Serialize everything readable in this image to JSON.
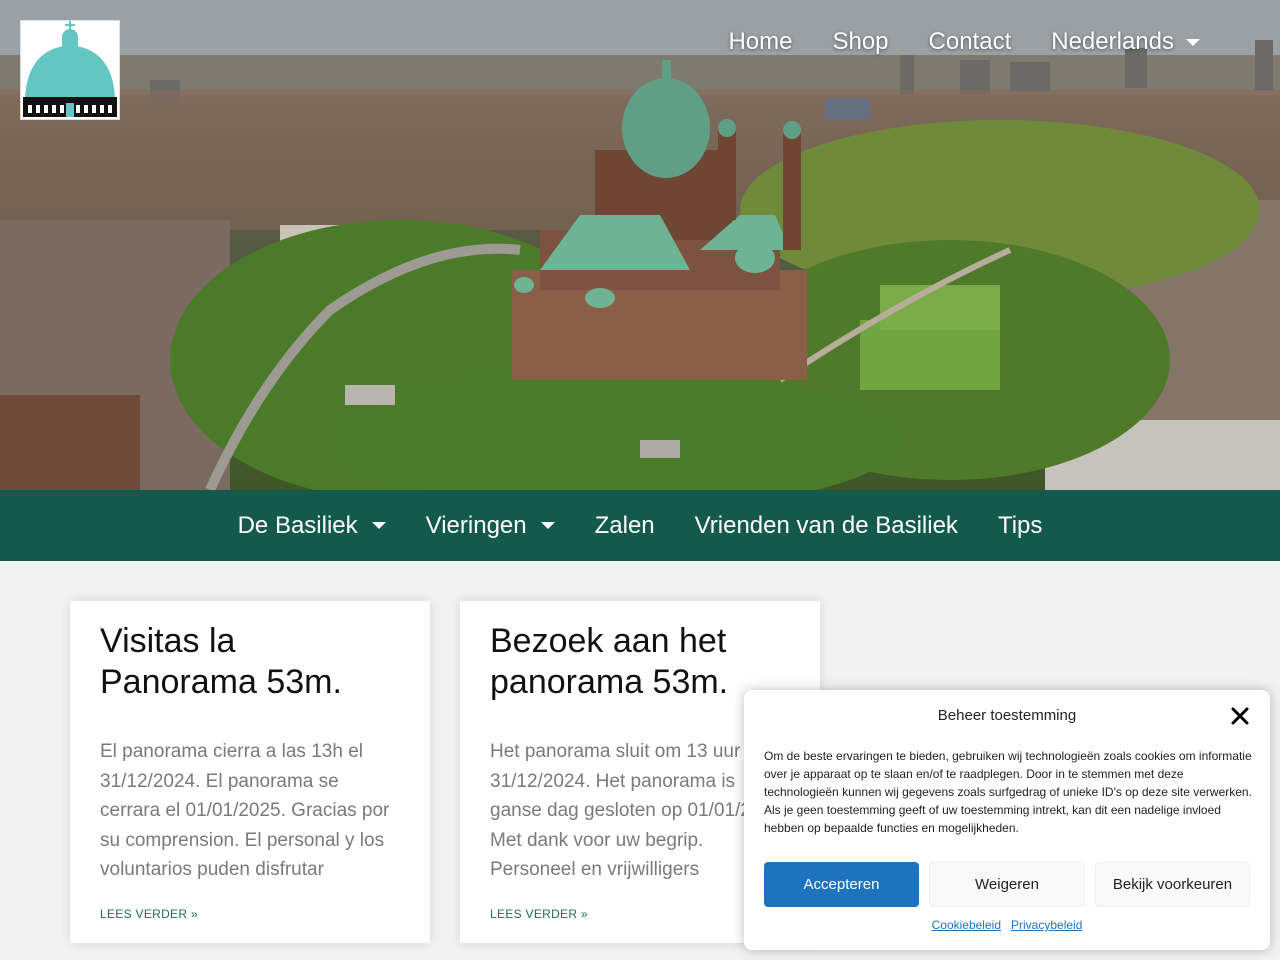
{
  "brand": {
    "logo_icon": "basilica-logo-icon",
    "accent": "#135a4c",
    "logo_color": "#63c6c3"
  },
  "topnav": {
    "items": [
      {
        "label": "Home"
      },
      {
        "label": "Shop"
      },
      {
        "label": "Contact"
      },
      {
        "label": "Nederlands",
        "dropdown": true
      }
    ]
  },
  "mainnav": {
    "items": [
      {
        "label": "De Basiliek",
        "dropdown": true
      },
      {
        "label": "Vieringen",
        "dropdown": true
      },
      {
        "label": "Zalen"
      },
      {
        "label": "Vrienden van de Basiliek"
      },
      {
        "label": "Tips"
      }
    ]
  },
  "posts": [
    {
      "title": "Visitas la Panorama 53m.",
      "excerpt": "El panorama cierra a las 13h el 31/12/2024. El panorama se cerrara el 01/01/2025. Gracias por su comprension. El personal y los voluntarios puden disfrutar",
      "more": "LEES VERDER »"
    },
    {
      "title": "Bezoek aan het panorama 53m.",
      "excerpt": "Het panorama sluit om 13 uur 31/12/2024. Het panorama is ganse dag gesloten op 01/01/2025. Met dank voor uw begrip. Personeel en vrijwilligers",
      "more": "LEES VERDER »"
    }
  ],
  "consent": {
    "title": "Beheer toestemming",
    "text": "Om de beste ervaringen te bieden, gebruiken wij technologieën zoals cookies om informatie over je apparaat op te slaan en/of te raadplegen. Door in te stemmen met deze technologieën kunnen wij gegevens zoals surfgedrag of unieke ID's op deze site verwerken. Als je geen toestemming geeft of uw toestemming intrekt, kan dit een nadelige invloed hebben op bepaalde functies en mogelijkheden.",
    "accept": "Accepteren",
    "deny": "Weigeren",
    "preferences": "Bekijk voorkeuren",
    "cookie_policy": "Cookiebeleid",
    "privacy_policy": "Privacybeleid",
    "accept_color": "#1e73be"
  }
}
